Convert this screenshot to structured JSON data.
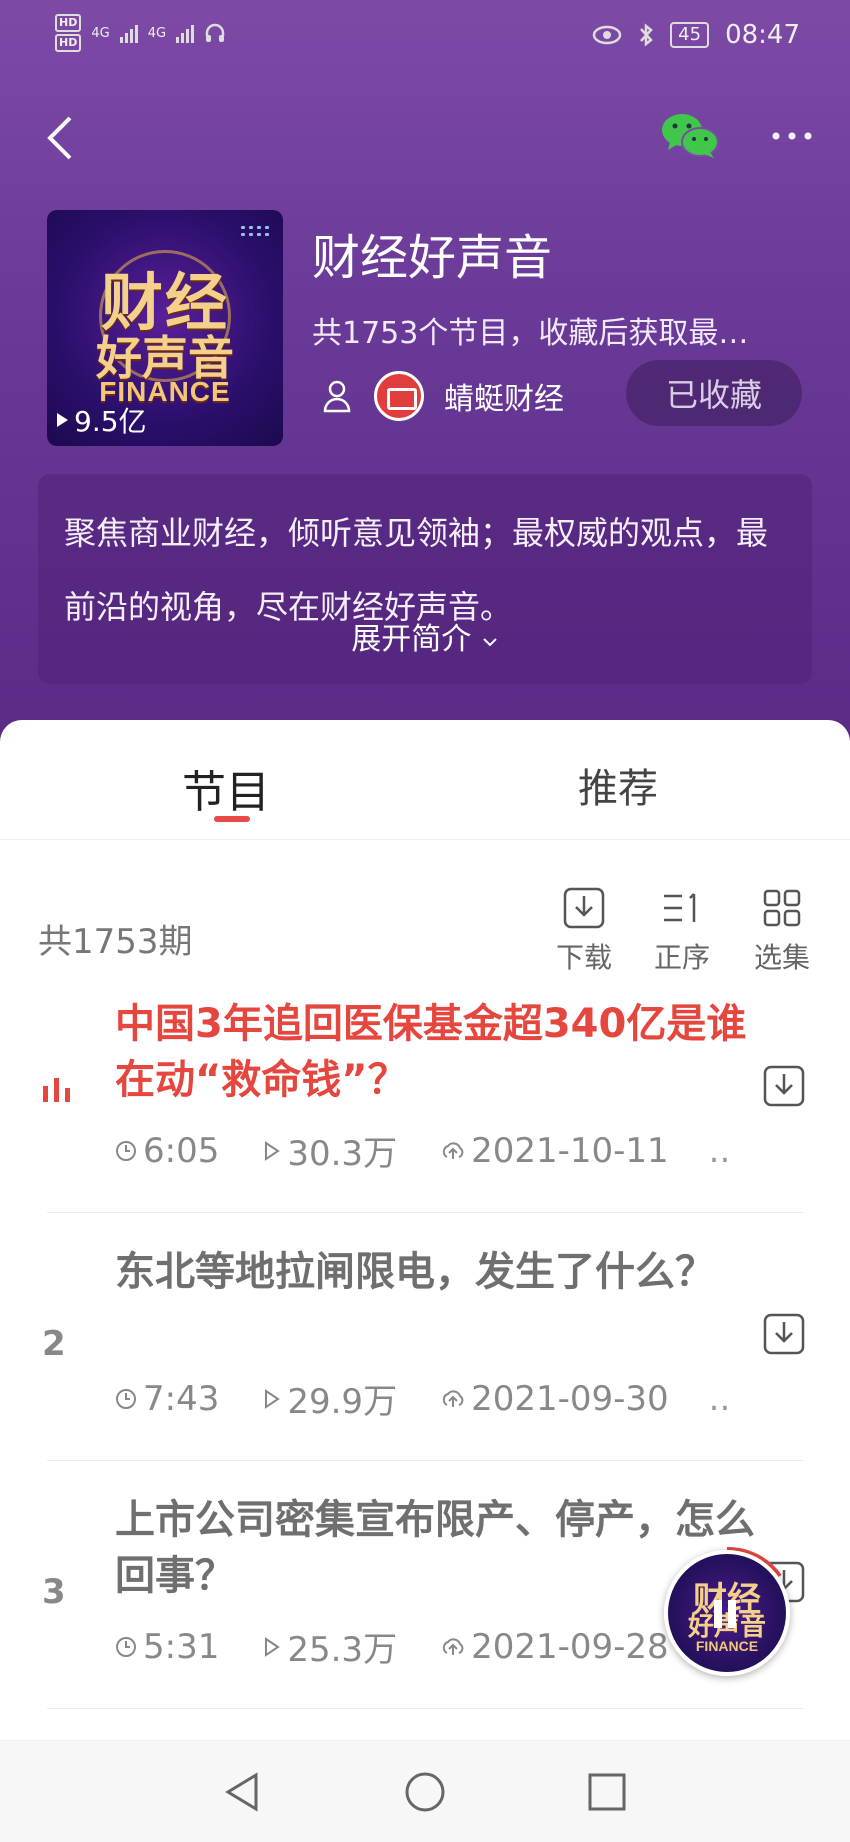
{
  "status_bar": {
    "hd1": "HD",
    "hd2": "HD",
    "network1": "4G",
    "network2": "4G",
    "battery": "45",
    "time": "08:47"
  },
  "header": {
    "back_icon": "chevron-left-icon",
    "share_icon": "wechat-icon",
    "more_icon": "more-icon"
  },
  "album": {
    "cover_line1": "财经",
    "cover_line2": "好声音",
    "cover_line3": "FINANCE",
    "play_count": "9.5亿",
    "title": "财经好声音",
    "subtitle": "共1753个节目，收藏后获取最…",
    "author": "蜻蜓财经",
    "favorite_label": "已收藏",
    "intro": "聚焦商业财经，倾听意见领袖；最权威的观点，最前沿的视角，尽在财经好声音。",
    "intro_expand": "展开简介"
  },
  "tabs": [
    {
      "label": "节目",
      "active": true
    },
    {
      "label": "推荐",
      "active": false
    }
  ],
  "list_header": {
    "count": "共1753期",
    "tools": [
      {
        "label": "下载",
        "icon": "download-icon"
      },
      {
        "label": "正序",
        "icon": "sort-icon"
      },
      {
        "label": "选集",
        "icon": "grid-icon"
      }
    ]
  },
  "episodes": [
    {
      "index": "",
      "playing": true,
      "title": "中国3年追回医保基金超340亿是谁在动“救命钱”？",
      "duration": "6:05",
      "plays": "30.3万",
      "date": "2021-10-11",
      "more": ".."
    },
    {
      "index": "2",
      "playing": false,
      "title": "东北等地拉闸限电，发生了什么？",
      "duration": "7:43",
      "plays": "29.9万",
      "date": "2021-09-30",
      "more": ".."
    },
    {
      "index": "3",
      "playing": false,
      "title": "上市公司密集宣布限产、停产，怎么回事？",
      "duration": "5:31",
      "plays": "25.3万",
      "date": "2021-09-28",
      "more": ""
    }
  ],
  "mini_player": {
    "line1": "财经",
    "line2": "好声音",
    "line3": "FINANCE"
  },
  "colors": {
    "accent": "#e5473f",
    "hero_top": "#7d4aa6",
    "hero_bottom": "#5a2a85"
  }
}
